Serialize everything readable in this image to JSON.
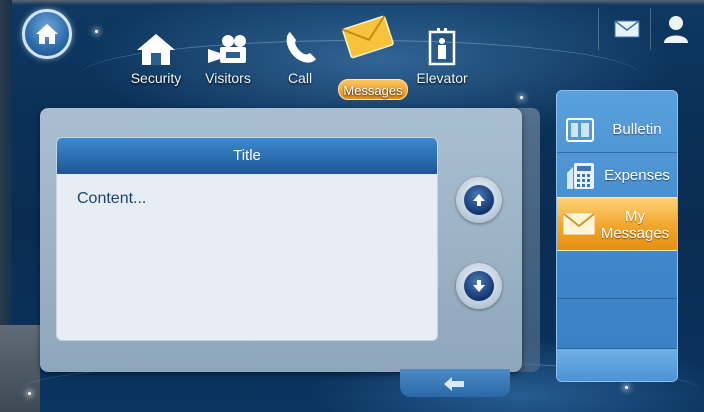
{
  "nav": {
    "items": [
      {
        "label": "Security",
        "icon": "house-icon"
      },
      {
        "label": "Visitors",
        "icon": "video-camera-icon"
      },
      {
        "label": "Call",
        "icon": "phone-icon"
      },
      {
        "label": "Messages",
        "icon": "envelope-icon",
        "active": true
      },
      {
        "label": "Elevator",
        "icon": "elevator-icon"
      }
    ]
  },
  "message": {
    "title": "Title",
    "content": "Content..."
  },
  "sidebar": {
    "items": [
      {
        "label": "Bulletin",
        "icon": "bulletin-icon"
      },
      {
        "label": "Expenses",
        "icon": "calculator-icon"
      },
      {
        "label": "My Messages",
        "icon": "envelope-icon",
        "active": true
      }
    ]
  },
  "colors": {
    "accent": "#f2a52b",
    "header": "#2d6fb3",
    "background": "#0b3158"
  }
}
